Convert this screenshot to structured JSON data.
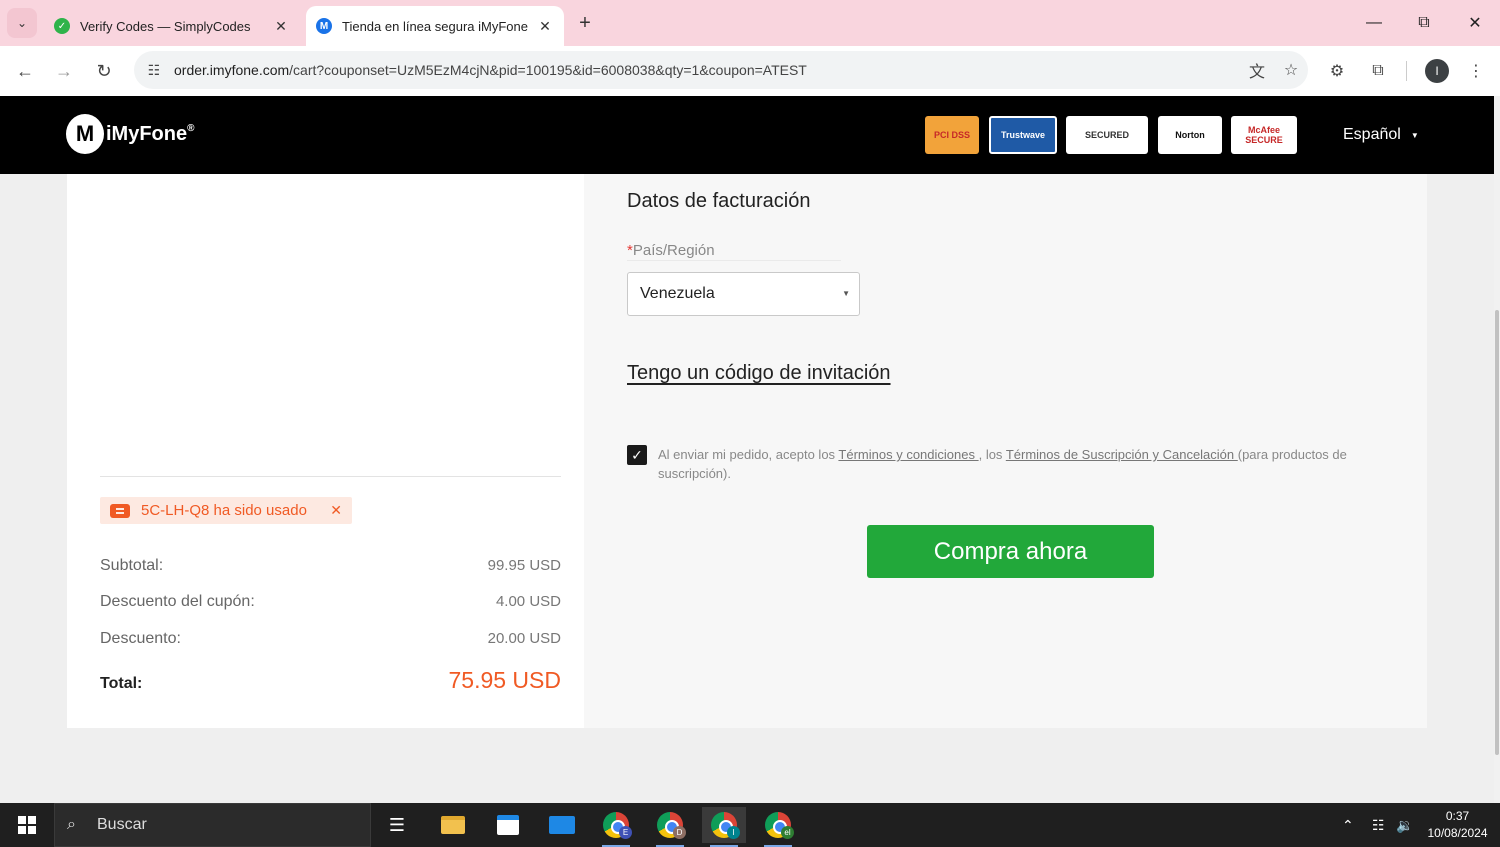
{
  "browser": {
    "tabs": [
      {
        "title": "Verify Codes — SimplyCodes",
        "favicon_color": "#2fb34a"
      },
      {
        "title": "Tienda en línea segura iMyFone",
        "favicon_color": "#1a73e8"
      }
    ],
    "url_host": "order.imyfone.com",
    "url_path": "/cart?couponset=UzM5EzM4cjN&pid=100195&id=6008038&qty=1&coupon=ATEST",
    "profile_initial": "I"
  },
  "header": {
    "logo_text": "iMyFone",
    "logo_mark": "M",
    "logo_reg": "®",
    "badges": [
      {
        "name": "pcl-badge",
        "text": "PCI DSS"
      },
      {
        "name": "trustwave-badge",
        "text": "Trustwave"
      },
      {
        "name": "ssl-secured-badge",
        "text": "SECURED"
      },
      {
        "name": "norton-badge",
        "text": "Norton"
      },
      {
        "name": "mcafee-badge",
        "text": "McAfee SECURE"
      }
    ],
    "language": "Español"
  },
  "summary": {
    "coupon_used": "5C-LH-Q8 ha sido usado",
    "subtotal_label": "Subtotal:",
    "subtotal_value": "99.95 USD",
    "coupon_discount_label": "Descuento del cupón:",
    "coupon_discount_value": "4.00 USD",
    "discount_label": "Descuento:",
    "discount_value": "20.00 USD",
    "total_label": "Total:",
    "total_value": "75.95 USD"
  },
  "billing": {
    "title": "Datos de facturación",
    "country_label_required": "*",
    "country_label": "País/Región",
    "country_value": "Venezuela",
    "invite_link": "Tengo un código de invitación",
    "terms_prefix": "Al enviar mi pedido, acepto los ",
    "terms_link1": "Términos y condiciones ",
    "terms_mid": ", los ",
    "terms_link2": "Términos de Suscripción y Cancelación ",
    "terms_suffix": "(para productos de suscripción).",
    "terms_checked": true,
    "buy_button": "Compra ahora"
  },
  "taskbar": {
    "search_placeholder": "Buscar",
    "chrome_profiles": [
      {
        "badge": "E",
        "color": "#3f51b5"
      },
      {
        "badge": "D",
        "color": "#8d6e63"
      },
      {
        "badge": "I",
        "color": "#00838f"
      },
      {
        "badge": "el",
        "color": "#2e7d32"
      }
    ],
    "time": "0:37",
    "date": "10/08/2024"
  }
}
